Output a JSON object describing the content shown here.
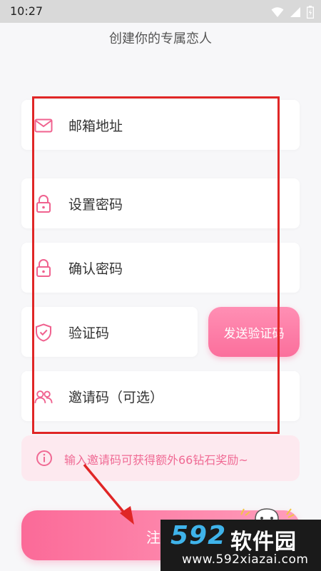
{
  "status_bar": {
    "time": "10:27",
    "icons": [
      "wifi-icon",
      "signal-icon",
      "battery-icon"
    ]
  },
  "page": {
    "title": "创建你的专属恋人"
  },
  "form": {
    "email": {
      "label": "邮箱地址",
      "icon": "mail-icon"
    },
    "password": {
      "label": "设置密码",
      "icon": "lock-icon"
    },
    "confirm_password": {
      "label": "确认密码",
      "icon": "lock-icon"
    },
    "verification_code": {
      "label": "验证码",
      "icon": "shield-check-icon"
    },
    "invite_code": {
      "label": "邀请码（可选）",
      "icon": "users-icon"
    },
    "send_code_button": "发送验证码"
  },
  "hint": {
    "icon": "info-icon",
    "text": "输入邀请码可获得额外66钻石奖励~"
  },
  "register": {
    "label": "注"
  },
  "watermark": {
    "logo_number": "592",
    "logo_text": "软件园",
    "url": "www.592xiazai.com"
  },
  "colors": {
    "accent": "#fb6f9c",
    "hint_background": "#fde9ef",
    "annotation": "#e02626"
  }
}
